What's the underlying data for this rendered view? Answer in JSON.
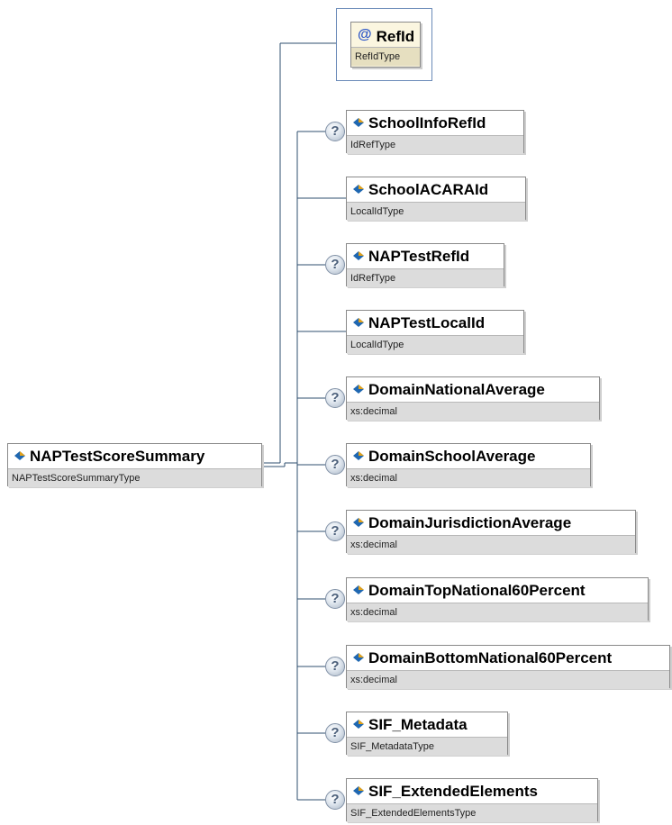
{
  "attribute": {
    "name": "RefId",
    "type": "RefIdType",
    "icon": "attribute-at-icon"
  },
  "root": {
    "name": "NAPTestScoreSummary",
    "type": "NAPTestScoreSummaryType",
    "icon": "element-diamond-icon"
  },
  "optional_marker": "?",
  "elements": [
    {
      "name": "SchoolInfoRefId",
      "type": "IdRefType",
      "optional": true
    },
    {
      "name": "SchoolACARAId",
      "type": "LocalIdType",
      "optional": false
    },
    {
      "name": "NAPTestRefId",
      "type": "IdRefType",
      "optional": true
    },
    {
      "name": "NAPTestLocalId",
      "type": "LocalIdType",
      "optional": false
    },
    {
      "name": "DomainNationalAverage",
      "type": "xs:decimal",
      "optional": true
    },
    {
      "name": "DomainSchoolAverage",
      "type": "xs:decimal",
      "optional": true
    },
    {
      "name": "DomainJurisdictionAverage",
      "type": "xs:decimal",
      "optional": true
    },
    {
      "name": "DomainTopNational60Percent",
      "type": "xs:decimal",
      "optional": true
    },
    {
      "name": "DomainBottomNational60Percent",
      "type": "xs:decimal",
      "optional": true
    },
    {
      "name": "SIF_Metadata",
      "type": "SIF_MetadataType",
      "optional": true
    },
    {
      "name": "SIF_ExtendedElements",
      "type": "SIF_ExtendedElementsType",
      "optional": true
    }
  ],
  "colors": {
    "connector": "#2f4f6f",
    "attribute_frame": "#6a8ab8",
    "type_band": "#dcdcdc",
    "optional_badge": "#a9b6c6"
  }
}
